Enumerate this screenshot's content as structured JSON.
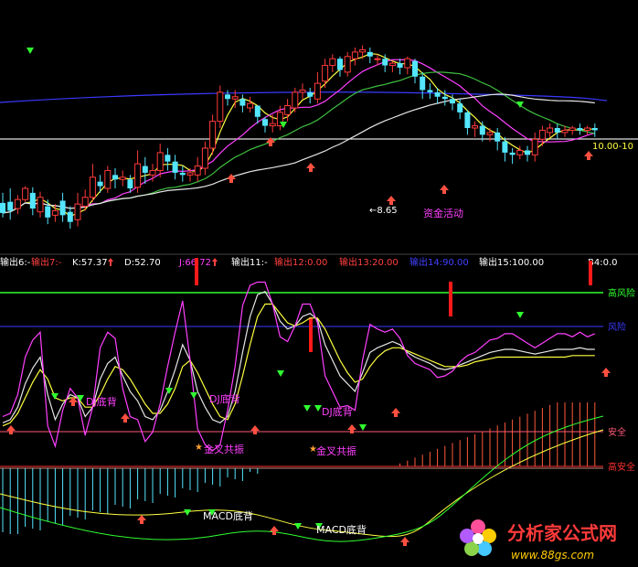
{
  "chart_data": [
    {
      "type": "candlestick",
      "panel": "price",
      "labels": {
        "price_level": "10.00-10",
        "low_marker": "8.65",
        "annotation": "资金活动"
      },
      "candles": [
        [
          0,
          83,
          74,
          70,
          92
        ],
        [
          1,
          84,
          76,
          68,
          96
        ],
        [
          2,
          78,
          86,
          73,
          90
        ],
        [
          3,
          86,
          96,
          84,
          98
        ],
        [
          4,
          92,
          78,
          72,
          97
        ],
        [
          5,
          75,
          88,
          70,
          93
        ],
        [
          6,
          80,
          70,
          64,
          86
        ],
        [
          7,
          72,
          76,
          66,
          82
        ],
        [
          8,
          85,
          72,
          66,
          92
        ],
        [
          9,
          75,
          66,
          60,
          80
        ],
        [
          10,
          68,
          82,
          62,
          92
        ],
        [
          11,
          80,
          88,
          76,
          95
        ],
        [
          12,
          88,
          106,
          84,
          118
        ],
        [
          13,
          102,
          98,
          92,
          108
        ],
        [
          14,
          96,
          112,
          92,
          116
        ],
        [
          15,
          108,
          104,
          96,
          114
        ],
        [
          16,
          104,
          106,
          98,
          112
        ],
        [
          17,
          104,
          96,
          92,
          108
        ],
        [
          18,
          97,
          118,
          92,
          130
        ],
        [
          19,
          116,
          110,
          100,
          124
        ],
        [
          20,
          108,
          112,
          102,
          118
        ],
        [
          21,
          112,
          128,
          106,
          136
        ],
        [
          22,
          126,
          120,
          112,
          132
        ],
        [
          23,
          120,
          110,
          104,
          126
        ],
        [
          24,
          110,
          108,
          102,
          116
        ],
        [
          25,
          108,
          110,
          102,
          114
        ],
        [
          26,
          108,
          116,
          102,
          124
        ],
        [
          27,
          114,
          132,
          108,
          138
        ],
        [
          28,
          132,
          156,
          126,
          162
        ],
        [
          29,
          156,
          182,
          150,
          188
        ],
        [
          30,
          180,
          176,
          170,
          184
        ],
        [
          31,
          176,
          178,
          168,
          184
        ],
        [
          32,
          176,
          170,
          164,
          180
        ],
        [
          33,
          168,
          172,
          164,
          178
        ],
        [
          34,
          170,
          160,
          154,
          168
        ],
        [
          35,
          158,
          152,
          146,
          160
        ],
        [
          36,
          152,
          154,
          146,
          162
        ],
        [
          37,
          152,
          164,
          148,
          170
        ],
        [
          38,
          162,
          170,
          156,
          176
        ],
        [
          39,
          168,
          182,
          164,
          186
        ],
        [
          40,
          182,
          184,
          176,
          190
        ],
        [
          41,
          182,
          178,
          172,
          186
        ],
        [
          42,
          176,
          190,
          172,
          200
        ],
        [
          43,
          192,
          206,
          186,
          212
        ],
        [
          44,
          206,
          212,
          200,
          216
        ],
        [
          45,
          212,
          202,
          196,
          214
        ],
        [
          46,
          200,
          214,
          196,
          218
        ],
        [
          47,
          212,
          218,
          206,
          222
        ],
        [
          48,
          218,
          220,
          212,
          224
        ],
        [
          49,
          218,
          214,
          208,
          222
        ],
        [
          50,
          212,
          212,
          206,
          216
        ],
        [
          51,
          212,
          206,
          200,
          216
        ],
        [
          52,
          206,
          208,
          200,
          210
        ],
        [
          53,
          208,
          204,
          198,
          212
        ],
        [
          54,
          204,
          212,
          198,
          214
        ],
        [
          55,
          210,
          196,
          190,
          212
        ],
        [
          56,
          196,
          184,
          176,
          200
        ],
        [
          57,
          184,
          182,
          176,
          190
        ],
        [
          58,
          182,
          178,
          172,
          186
        ],
        [
          59,
          178,
          176,
          170,
          184
        ],
        [
          60,
          176,
          172,
          166,
          180
        ],
        [
          61,
          172,
          164,
          158,
          176
        ],
        [
          62,
          164,
          150,
          144,
          166
        ],
        [
          63,
          150,
          152,
          142,
          156
        ],
        [
          64,
          152,
          144,
          138,
          156
        ],
        [
          65,
          144,
          146,
          138,
          150
        ],
        [
          66,
          146,
          138,
          130,
          150
        ],
        [
          67,
          138,
          128,
          120,
          142
        ],
        [
          68,
          128,
          126,
          118,
          132
        ],
        [
          69,
          126,
          130,
          122,
          134
        ],
        [
          70,
          130,
          126,
          120,
          134
        ],
        [
          71,
          126,
          140,
          120,
          146
        ],
        [
          72,
          140,
          148,
          134,
          152
        ],
        [
          73,
          146,
          150,
          142,
          154
        ],
        [
          74,
          150,
          146,
          140,
          154
        ],
        [
          75,
          146,
          148,
          142,
          152
        ],
        [
          76,
          148,
          150,
          144,
          152
        ],
        [
          77,
          150,
          148,
          144,
          154
        ],
        [
          78,
          148,
          150,
          144,
          152
        ],
        [
          79,
          150,
          148,
          142,
          154
        ]
      ]
    },
    {
      "type": "line",
      "panel": "indicator",
      "labels": {
        "legend": [
          {
            "text": "输出6:-",
            "color": "#ffffff"
          },
          {
            "text": "输出7:-",
            "color": "#ff4040"
          },
          {
            "text": "K:57.37",
            "color": "#ffffff"
          },
          {
            "text": "D:52.70",
            "color": "#ffffff"
          },
          {
            "text": "J:66.72",
            "color": "#ff40ff"
          },
          {
            "text": "输出11:-",
            "color": "#ffffff"
          },
          {
            "text": "输出12:0.00",
            "color": "#ff4040"
          },
          {
            "text": "输出13:20.00",
            "color": "#ff4040"
          },
          {
            "text": "输出14:90.00",
            "color": "#4040ff"
          },
          {
            "text": "输出15:100.00",
            "color": "#ffffff"
          },
          {
            "text": "B4:0.0",
            "color": "#ffffff"
          }
        ],
        "level_labels": [
          "高风险",
          "风险",
          "安全",
          "高安全"
        ],
        "annotations": [
          {
            "text": "DJ底背",
            "color": "#ff40ff"
          },
          {
            "text": "DJ底背",
            "color": "#ff40ff"
          },
          {
            "text": "DJ底背",
            "color": "#ff40ff"
          },
          {
            "text": "金叉共振",
            "color": "#ff40ff"
          },
          {
            "text": "金叉共振",
            "color": "#ff40ff"
          },
          {
            "text": "MACD底背",
            "color": "#ffffff"
          },
          {
            "text": "MACD底背",
            "color": "#ffffff"
          }
        ]
      },
      "x": [
        0,
        1,
        2,
        3,
        4,
        5,
        6,
        7,
        8,
        9,
        10,
        11,
        12,
        13,
        14,
        15,
        16,
        17,
        18,
        19,
        20,
        21,
        22,
        23,
        24,
        25,
        26,
        27,
        28,
        29,
        30,
        31,
        32,
        33,
        34,
        35,
        36,
        37,
        38,
        39,
        40,
        41,
        42,
        43,
        44,
        45,
        46,
        47,
        48,
        49,
        50,
        51,
        52,
        53,
        54,
        55,
        56,
        57,
        58,
        59,
        60,
        61,
        62,
        63,
        64,
        65,
        66,
        67,
        68,
        69,
        70,
        71,
        72,
        73,
        74,
        75,
        76,
        77,
        78,
        79
      ],
      "series": [
        {
          "name": "K",
          "values": [
            10,
            12,
            20,
            35,
            45,
            52,
            28,
            12,
            22,
            28,
            26,
            14,
            20,
            38,
            48,
            52,
            40,
            30,
            24,
            14,
            12,
            18,
            30,
            44,
            60,
            50,
            30,
            20,
            12,
            10,
            14,
            30,
            55,
            78,
            92,
            94,
            86,
            75,
            70,
            72,
            78,
            80,
            76,
            60,
            50,
            40,
            35,
            30,
            42,
            55,
            58,
            60,
            62,
            60,
            55,
            52,
            50,
            48,
            45,
            44,
            45,
            47,
            49,
            51,
            53,
            55,
            56,
            57,
            57,
            56,
            55,
            54,
            55,
            56,
            57,
            57,
            57,
            58,
            57,
            57
          ]
        },
        {
          "name": "D",
          "values": [
            8,
            10,
            16,
            26,
            36,
            44,
            38,
            26,
            24,
            26,
            26,
            20,
            20,
            28,
            38,
            46,
            44,
            38,
            30,
            22,
            16,
            16,
            22,
            32,
            46,
            50,
            42,
            32,
            22,
            14,
            12,
            22,
            40,
            60,
            78,
            86,
            86,
            80,
            74,
            72,
            74,
            77,
            77,
            70,
            60,
            50,
            42,
            36,
            38,
            46,
            52,
            56,
            58,
            58,
            56,
            54,
            52,
            50,
            48,
            46,
            46,
            46,
            47,
            49,
            50,
            51,
            52,
            52,
            52,
            52,
            52,
            52,
            52,
            52,
            52,
            52,
            53,
            53,
            53,
            53
          ]
        },
        {
          "name": "J",
          "values": [
            14,
            16,
            28,
            52,
            63,
            68,
            8,
            -5,
            18,
            32,
            26,
            2,
            20,
            58,
            68,
            64,
            32,
            14,
            12,
            -2,
            4,
            22,
            46,
            68,
            88,
            50,
            6,
            -4,
            -8,
            -4,
            18,
            46,
            85,
            98,
            100,
            100,
            86,
            65,
            62,
            72,
            86,
            86,
            74,
            40,
            30,
            20,
            21,
            18,
            50,
            73,
            70,
            68,
            70,
            64,
            53,
            48,
            46,
            44,
            39,
            40,
            43,
            49,
            53,
            55,
            59,
            63,
            64,
            67,
            67,
            64,
            61,
            58,
            61,
            64,
            67,
            67,
            65,
            68,
            65,
            67
          ]
        }
      ]
    }
  ],
  "brand": {
    "logo_text": "分析家公式网",
    "url_text": "www.88gs.com"
  }
}
